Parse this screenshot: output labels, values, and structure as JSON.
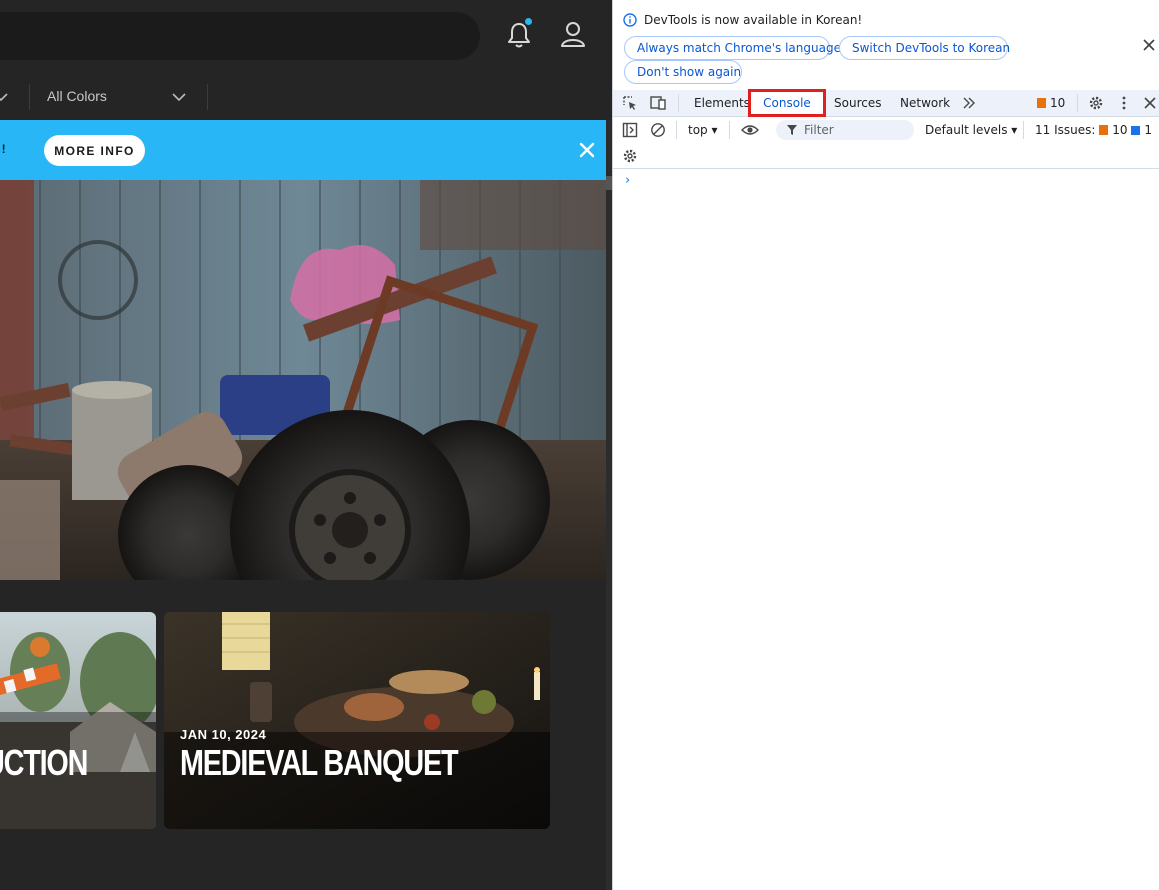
{
  "site": {
    "filter": {
      "colors_label": "All Colors"
    },
    "banner": {
      "text": "B!",
      "button_label": "MORE INFO"
    },
    "cards": [
      {
        "date": "",
        "title": "TRUCTION"
      },
      {
        "date": "JAN 10, 2024",
        "title": "MEDIEVAL BANQUET"
      }
    ]
  },
  "devtools": {
    "infobar": {
      "message": "DevTools is now available in Korean!",
      "buttons": [
        "Always match Chrome's language",
        "Switch DevTools to Korean",
        "Don't show again"
      ]
    },
    "tabs": [
      "Elements",
      "Console",
      "Sources",
      "Network"
    ],
    "active_tab": "Console",
    "issue_badge_count": "10",
    "toolbar": {
      "context": "top",
      "filter_placeholder": "Filter",
      "levels": "Default levels",
      "issues_label": "11 Issues:",
      "issues_warnings": "10",
      "issues_info": "1"
    },
    "prompt": "›"
  },
  "colors": {
    "banner": "#29b6f6",
    "highlight": "#e0201e",
    "devtools_accent": "#0b57d0"
  }
}
